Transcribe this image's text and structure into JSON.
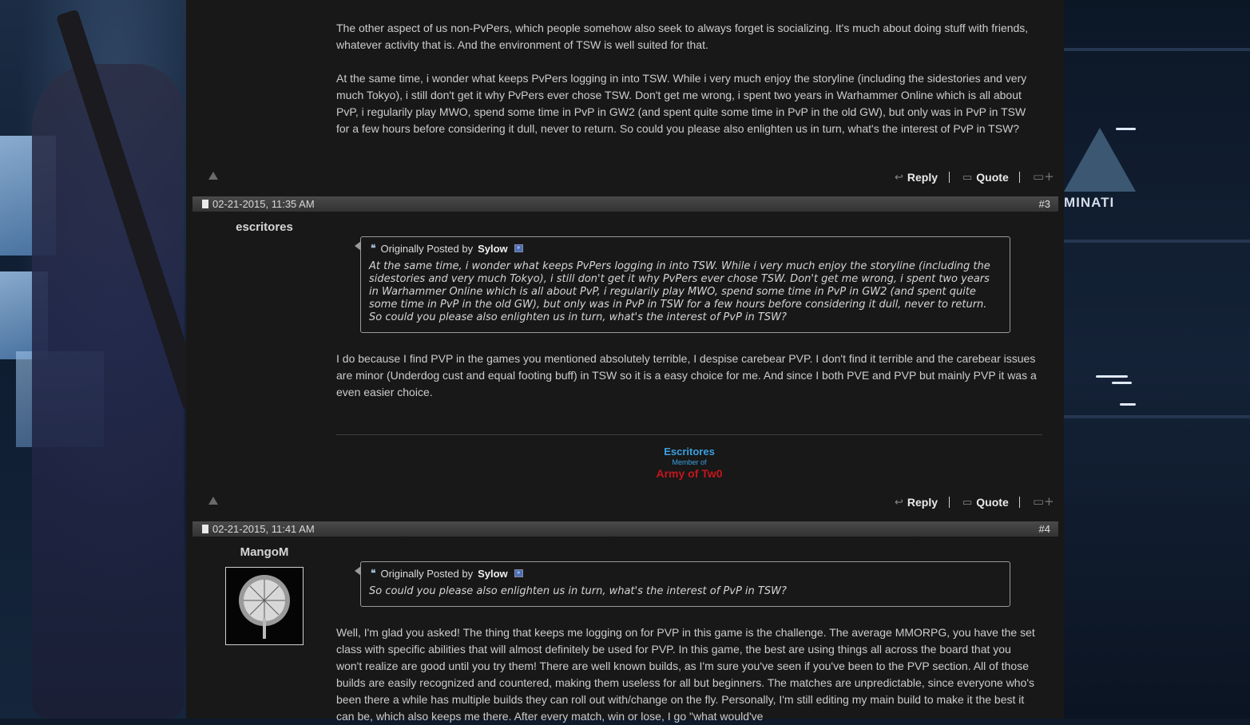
{
  "post2": {
    "paragraphs": [
      "The other aspect of us non-PvPers, which people somehow also seek to always forget is socializing. It's much about doing stuff with friends, whatever activity that is. And the environment of TSW is well suited for that.",
      "At the same time, i wonder what keeps PvPers logging in into TSW. While i very much enjoy the storyline (including the sidestories and very much Tokyo), i still don't get it why PvPers ever chose TSW. Don't get me wrong, i spent two years in Warhammer Online which is all about PvP, i regularily play MWO, spend some time in PvP in GW2 (and spent quite some time in PvP in the old GW), but only was in PvP in TSW for a few hours before considering it dull, never to return. So could you please also enlighten us in turn, what's the interest of PvP in TSW?"
    ]
  },
  "actions": {
    "reply_label": "Reply",
    "quote_label": "Quote"
  },
  "post3": {
    "date": "02-21-2015, 11:35 AM",
    "number": "#3",
    "username": "escritores",
    "quote": {
      "prefix": "Originally Posted by",
      "author": "Sylow",
      "text": "At the same time, i wonder what keeps PvPers logging in into TSW. While i very much enjoy the storyline (including the sidestories and very much Tokyo), i still don't get it why PvPers ever chose TSW. Don't get me wrong, i spent two years in Warhammer Online which is all about PvP, i regularily play MWO, spend some time in PvP in GW2 (and spent quite some time in PvP in the old GW), but only was in PvP in TSW for a few hours before considering it dull, never to return. So could you please also enlighten us in turn, what's the interest of PvP in TSW?"
    },
    "body": "I do because I find PVP in the games you mentioned absolutely terrible, I despise carebear PVP. I don't find it terrible and the carebear issues are minor (Underdog cust and equal footing buff) in TSW so it is a easy choice for me. And since I both PVE and PVP but mainly PVP it was a even easier choice.",
    "signature": {
      "name": "Escritores",
      "member_of": "Member of",
      "guild": "Army of Tw0"
    }
  },
  "post4": {
    "date": "02-21-2015, 11:41 AM",
    "number": "#4",
    "username": "MangoM",
    "quote": {
      "prefix": "Originally Posted by",
      "author": "Sylow",
      "text": "So could you please also enlighten us in turn, what's the interest of PvP in TSW?"
    },
    "body": "Well, I'm glad you asked! The thing that keeps me logging on for PVP in this game is the challenge. The average MMORPG, you have the set class with specific abilities that will almost definitely be used for PVP. In this game, the best are using things all across the board that you won't realize are good until you try them! There are well known builds, as I'm sure you've seen if you've been to the PVP section. All of those builds are easily recognized and countered, making them useless for all but beginners. The matches are unpredictable, since everyone who's been there a while has multiple builds they can roll out with/change on the fly. Personally, I'm still editing my main build to make it the best it can be, which also keeps me there. After every match, win or lose, I go \"what would've"
  },
  "background": {
    "emblem_text": "MINATI"
  },
  "colors": {
    "forum_bg": "#181818",
    "header_bar": "#404040",
    "signature_name": "#3aa0e0",
    "signature_guild": "#c4161c"
  }
}
